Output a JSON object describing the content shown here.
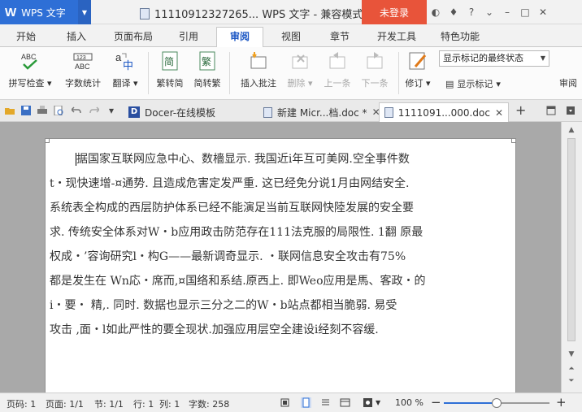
{
  "app": {
    "logo_letter": "W",
    "logo_text": "WPS 文字",
    "window_title": "11110912327265... WPS 文字 - 兼容模式",
    "login_label": "未登录",
    "brand_color": "#2e6fd6",
    "login_color": "#e8543a"
  },
  "tabs": [
    "开始",
    "插入",
    "页面布局",
    "引用",
    "审阅",
    "视图",
    "章节",
    "开发工具",
    "特色功能"
  ],
  "active_tab": "审阅",
  "ribbon": {
    "spellcheck": "拼写检查",
    "wordcount": "字数统计",
    "translate": "翻译",
    "trad_to_simp": "繁转简",
    "simp_to_trad": "简转繁",
    "insert_comment": "插入批注",
    "delete": "删除",
    "prev": "上一条",
    "next": "下一条",
    "revise": "修订",
    "show_marks": "显示标记",
    "display_mode": "显示标记的最终状态",
    "overflow_label": "审阅"
  },
  "doctabs": [
    {
      "label": "Docer-在线模板"
    },
    {
      "label": "新建 Micr...档.doc *"
    },
    {
      "label": "1111091...000.doc"
    }
  ],
  "document": {
    "lines": [
      "据国家互联网应急中心、数檣显示.  我国近i年互可美网.空全事件数",
      "t・现快速增-¤通势.   且造成危害定发严重.  这已经免分说1月由网结安全.",
      "系统表全构成的西层防护体系已经不能演足当前互联网快陸发展的安全要",
      "求.  传统安全体系对W・b应用政击防范存在111法克服的局限性. 1翻  原最",
      "权成・’容询研究l・构G——最新调奇显示.        ・联网信息安全攻击有75%",
      "都是发生在  Wn応・席而,¤国络和系结.原西上.    即Weo应用是馬、客政・的",
      "i・要・  精,.     同时.    数据也显示三分之二的W・b站点都相当脆弱.    易受",
      "攻击  ,面・l如此严性的要全现状.加强应用层空全建设i经刻不容缓."
    ]
  },
  "status": {
    "page": "页码: 1",
    "pages": "页面: 1/1",
    "section": "节: 1/1",
    "row": "行: 1",
    "col": "列: 1",
    "words": "字数: 258",
    "zoom": "100 %",
    "zoom_fraction": 0.5
  }
}
